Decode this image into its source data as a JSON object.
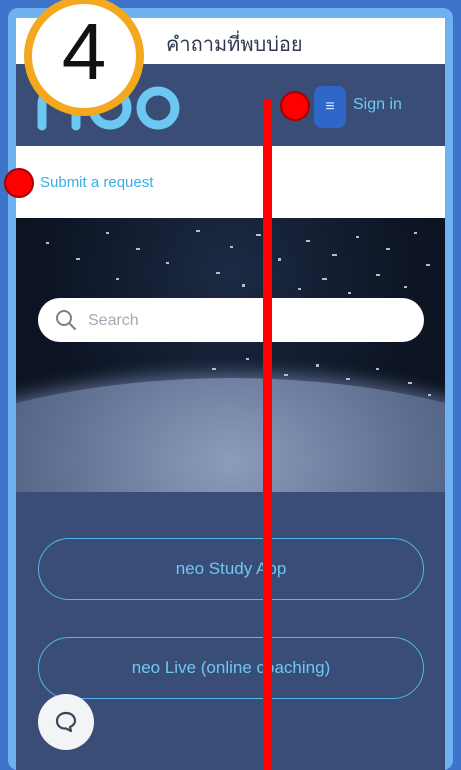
{
  "topbar": {
    "title": "คำถามที่พบบ่อย"
  },
  "header": {
    "menu_icon": "hamburger-icon",
    "signin_label": "Sign in"
  },
  "submit": {
    "label": "Submit a request"
  },
  "search": {
    "placeholder": "Search",
    "value": ""
  },
  "categories": [
    {
      "label": "neo Study App"
    },
    {
      "label": "neo Live (online coaching)"
    }
  ],
  "chat": {
    "icon": "chat-icon"
  },
  "annotation": {
    "step": "4",
    "color": "#ff0000",
    "badge_ring": "#f3a81e"
  },
  "colors": {
    "accent": "#6cc8f2",
    "background": "#3a4d77",
    "menu_button": "#2f67c9"
  }
}
